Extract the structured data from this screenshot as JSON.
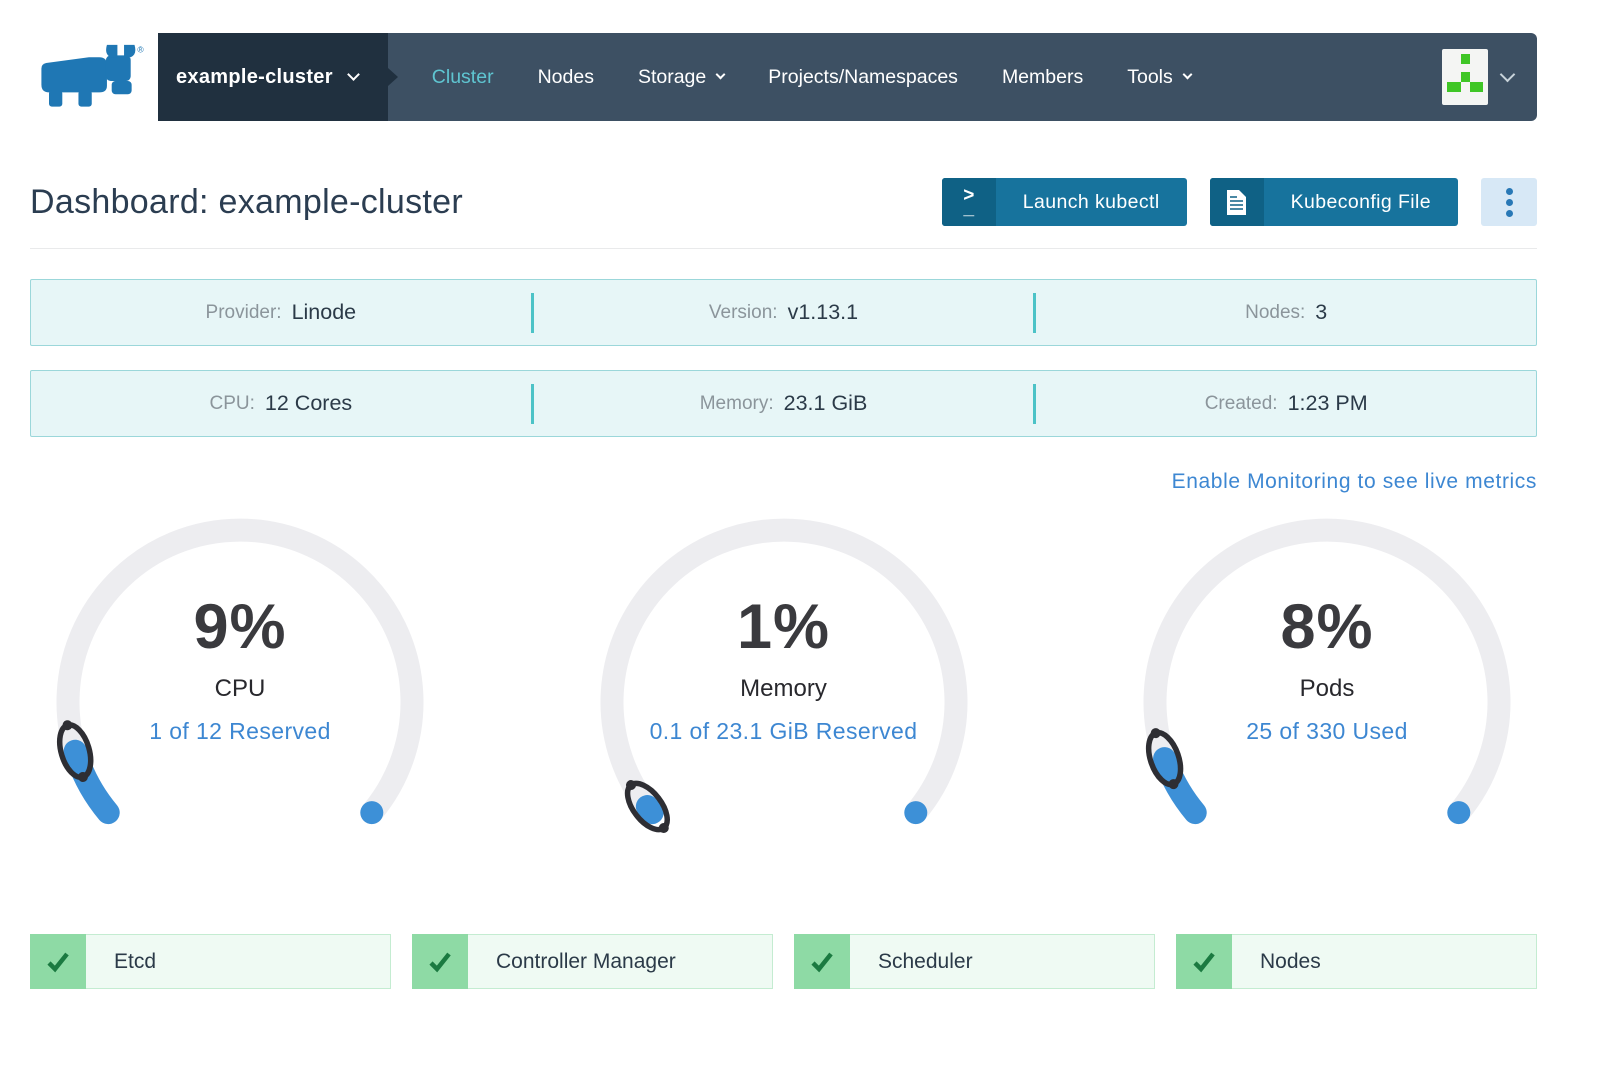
{
  "brand": {
    "name": "rancher-logo",
    "registered": "®"
  },
  "nav": {
    "cluster_selector": "example-cluster",
    "items": [
      {
        "label": "Cluster",
        "active": true
      },
      {
        "label": "Nodes",
        "active": false
      },
      {
        "label": "Storage",
        "active": false,
        "dropdown": true
      },
      {
        "label": "Projects/Namespaces",
        "active": false
      },
      {
        "label": "Members",
        "active": false
      },
      {
        "label": "Tools",
        "active": false,
        "dropdown": true
      }
    ]
  },
  "page": {
    "title": "Dashboard: example-cluster"
  },
  "actions": {
    "launch_kubectl": "Launch kubectl",
    "kubectl_icon_top": ">",
    "kubectl_icon_bottom": "_",
    "kubeconfig": "Kubeconfig File"
  },
  "info": {
    "row1": [
      {
        "label": "Provider:",
        "value": "Linode"
      },
      {
        "label": "Version:",
        "value": "v1.13.1"
      },
      {
        "label": "Nodes:",
        "value": "3"
      }
    ],
    "row2": [
      {
        "label": "CPU:",
        "value": "12 Cores"
      },
      {
        "label": "Memory:",
        "value": "23.1 GiB"
      },
      {
        "label": "Created:",
        "value": "1:23 PM"
      }
    ]
  },
  "monitoring_link": "Enable Monitoring to see live metrics",
  "chart_data": {
    "type": "gauge-set",
    "gauges": [
      {
        "percent": 9,
        "percent_label": "9%",
        "label": "CPU",
        "detail": "1 of 12 Reserved"
      },
      {
        "percent": 1,
        "percent_label": "1%",
        "label": "Memory",
        "detail": "0.1 of 23.1 GiB Reserved"
      },
      {
        "percent": 8,
        "percent_label": "8%",
        "label": "Pods",
        "detail": "25 of 330 Used"
      }
    ]
  },
  "components": [
    {
      "label": "Etcd",
      "status": "healthy"
    },
    {
      "label": "Controller Manager",
      "status": "healthy"
    },
    {
      "label": "Scheduler",
      "status": "healthy"
    },
    {
      "label": "Nodes",
      "status": "healthy"
    }
  ],
  "colors": {
    "navbar": "#3d5063",
    "navbar_dark": "#20303f",
    "nav_active": "#5fc5d1",
    "button": "#17739d",
    "button_icon": "#0f6185",
    "kebab_bg": "#d7e8f6",
    "info_bg": "#e7f6f7",
    "info_border": "#9bd7da",
    "info_divider": "#4cc3c7",
    "link_blue": "#3d87d2",
    "gauge_track": "#ededf0",
    "gauge_fill": "#3d90d7",
    "status_green": "#8edaa5",
    "status_green_light": "#effaf3",
    "check_green": "#1b7a41",
    "brand_blue": "#1f77b4",
    "avatar_green": "#3fc626"
  }
}
